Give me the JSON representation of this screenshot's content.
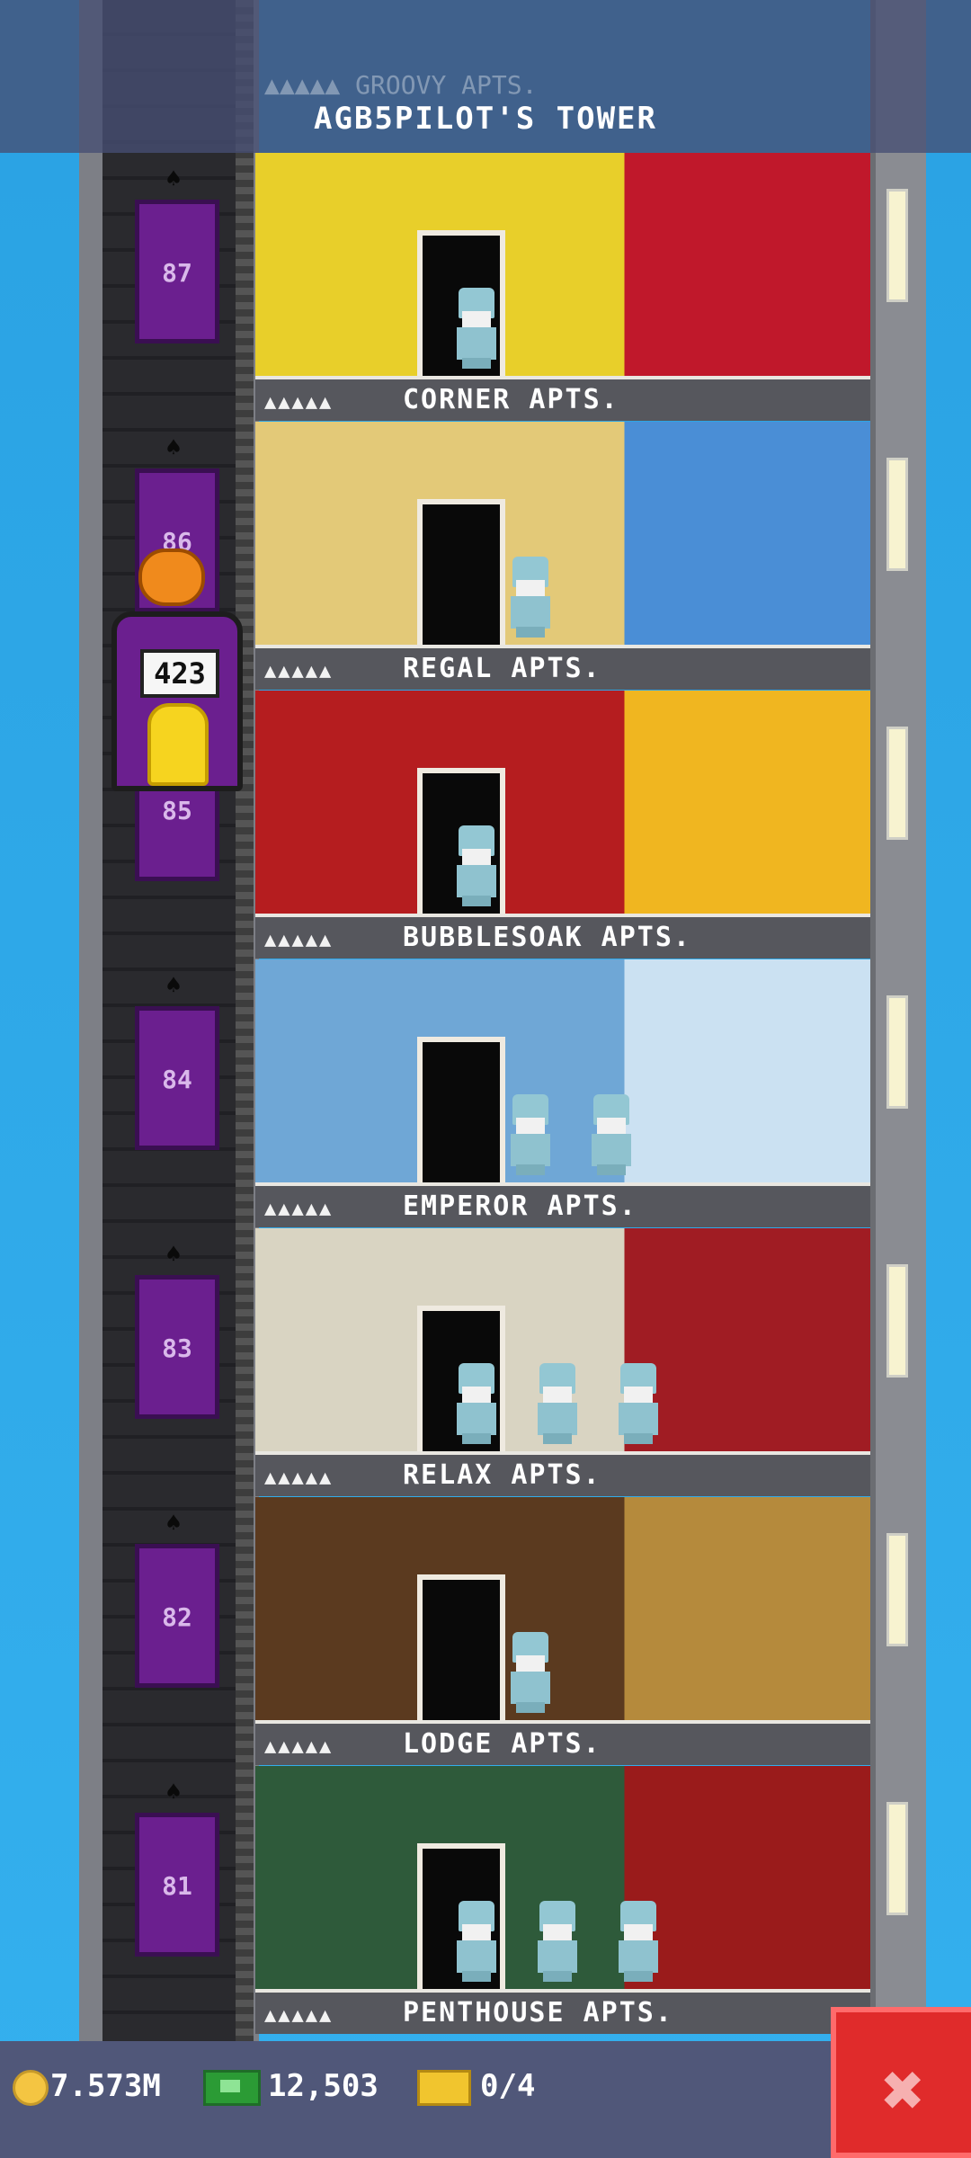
{
  "header": {
    "tower_title": "AGB5PILOT'S TOWER",
    "partial_floor_name": "GROOVY APTS."
  },
  "floors": [
    {
      "level": "87",
      "name": "CORNER APTS.",
      "stars": "▲▲▲▲▲",
      "wall": "#e8cf2a",
      "accent": "#c0182b",
      "residents": 1
    },
    {
      "level": "86",
      "name": "REGAL APTS.",
      "stars": "▲▲▲▲▲",
      "wall": "#e3c978",
      "accent": "#4a8ed6",
      "residents": 1
    },
    {
      "level": "85",
      "name": "BUBBLESOAK APTS.",
      "stars": "▲▲▲▲▲",
      "wall": "#b51d1f",
      "accent": "#f0b620",
      "residents": 1
    },
    {
      "level": "84",
      "name": "EMPEROR APTS.",
      "stars": "▲▲▲▲▲",
      "wall": "#6fa7d6",
      "accent": "#cbe1f2",
      "residents": 2
    },
    {
      "level": "83",
      "name": "RELAX APTS.",
      "stars": "▲▲▲▲▲",
      "wall": "#d9d4c2",
      "accent": "#a01c23",
      "residents": 3
    },
    {
      "level": "82",
      "name": "LODGE APTS.",
      "stars": "▲▲▲▲▲",
      "wall": "#5b3a1f",
      "accent": "#b58a3c",
      "residents": 1
    },
    {
      "level": "81",
      "name": "PENTHOUSE APTS.",
      "stars": "▲▲▲▲▲",
      "wall": "#2e5a3a",
      "accent": "#9a1b1b",
      "residents": 3
    }
  ],
  "elevator": {
    "car_label": "423",
    "current_floor_hidden": "85"
  },
  "resources": {
    "coins": "7.573M",
    "bux": "12,503",
    "tickets": "0/4"
  },
  "icons": [
    "coin-icon",
    "bux-icon",
    "ticket-icon",
    "bat-icon",
    "pumpkin-icon",
    "close-icon"
  ],
  "colors": {
    "sky": "#2fa9e8",
    "bar": "#505779",
    "close": "#e02b2b",
    "elevator_door": "#6b1f8f"
  }
}
